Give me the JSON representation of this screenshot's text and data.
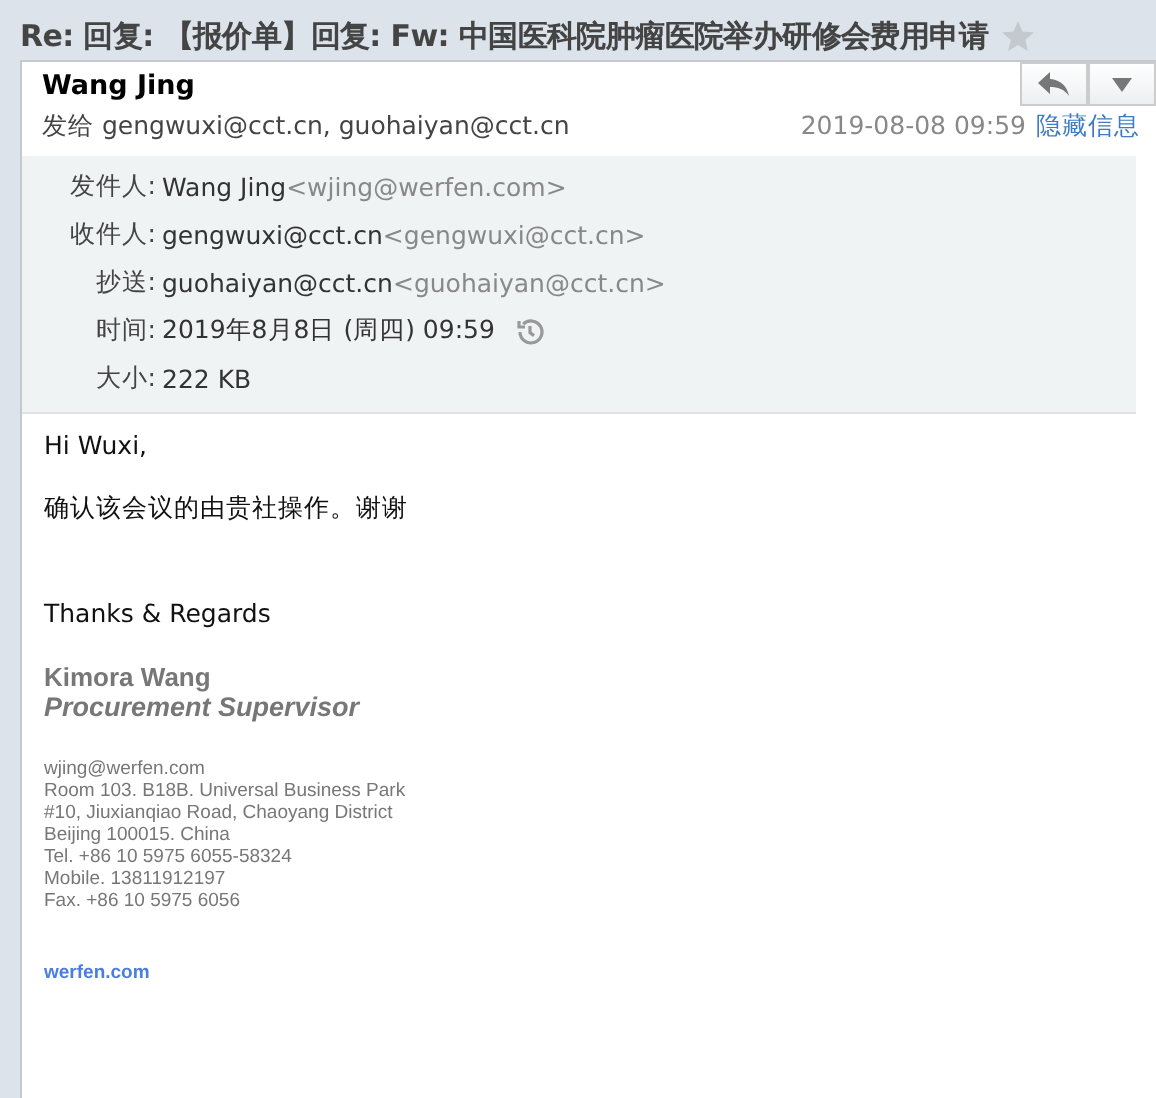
{
  "subject": "Re: 回复: 【报价单】回复: Fw: 中国医科院肿瘤医院举办研修会费用申请",
  "starred": false,
  "sender": "Wang Jing",
  "to_line": "发给 gengwuxi@cct.cn, guohaiyan@cct.cn",
  "date": "2019-08-08 09:59",
  "hide_link": "隐藏信息",
  "details": [
    {
      "label": "发件人:",
      "value": "Wang Jing",
      "address": "<wjing@werfen.com>"
    },
    {
      "label": "收件人:",
      "value": "gengwuxi@cct.cn",
      "address": "<gengwuxi@cct.cn>"
    },
    {
      "label": "抄送:",
      "value": "guohaiyan@cct.cn",
      "address": "<guohaiyan@cct.cn>"
    },
    {
      "label": "时间:",
      "value": "2019年8月8日 (周四) 09:59",
      "history": true
    },
    {
      "label": "大小:",
      "value": "222 KB"
    }
  ],
  "body": [
    "Hi Wuxi,",
    "确认该会议的由贵社操作。谢谢",
    "Thanks & Regards"
  ],
  "signature": {
    "name": "Kimora Wang",
    "title": "Procurement Supervisor",
    "lines": [
      "wjing@werfen.com",
      "Room 103. B18B. Universal Business Park",
      "#10, Jiuxianqiao Road, Chaoyang District",
      "Beijing 100015. China",
      "Tel. +86 10 5975 6055-58324",
      "Mobile. 13811912197",
      "Fax.  +86 10 5975 6056"
    ],
    "link": "werfen.com"
  }
}
